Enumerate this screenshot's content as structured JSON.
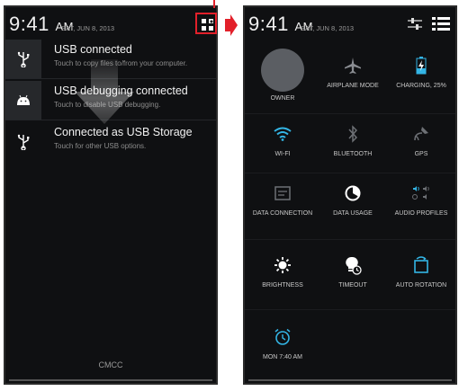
{
  "left_screen": {
    "clock": {
      "time": "9:41",
      "ampm": "AM",
      "date": "SAT, JUN 8, 2013"
    },
    "notifications": [
      {
        "icon": "usb-icon",
        "title": "USB connected",
        "subtitle": "Touch to copy files to/from your computer."
      },
      {
        "icon": "android-icon",
        "title": "USB debugging connected",
        "subtitle": "Touch to disable USB debugging."
      },
      {
        "icon": "usb-icon",
        "title": "Connected as USB Storage",
        "subtitle": "Touch for other USB options."
      }
    ],
    "carrier": "CMCC"
  },
  "right_screen": {
    "clock": {
      "time": "9:41",
      "ampm": "AM",
      "date": "SAT, JUN 8, 2013"
    },
    "tiles": [
      {
        "icon": "avatar",
        "label": "OWNER"
      },
      {
        "icon": "airplane-icon",
        "label": "AIRPLANE MODE"
      },
      {
        "icon": "charging-icon",
        "label": "CHARGING, 25%"
      },
      {
        "icon": "wifi-icon",
        "label": "WI-FI"
      },
      {
        "icon": "bluetooth-icon",
        "label": "BLUETOOTH"
      },
      {
        "icon": "gps-icon",
        "label": "GPS"
      },
      {
        "icon": "data-connection-icon",
        "label": "DATA CONNECTION"
      },
      {
        "icon": "data-usage-icon",
        "label": "DATA USAGE"
      },
      {
        "icon": "audio-profiles-icon",
        "label": "AUDIO PROFILES"
      },
      {
        "icon": "brightness-icon",
        "label": "BRIGHTNESS"
      },
      {
        "icon": "timeout-icon",
        "label": "TIMEOUT"
      },
      {
        "icon": "auto-rotation-icon",
        "label": "AUTO ROTATION"
      },
      {
        "icon": "alarm-icon",
        "label": "MON 7:40 AM"
      }
    ]
  },
  "colors": {
    "accent": "#33b5e5",
    "highlight": "#e2202a",
    "background": "#0f1012"
  }
}
